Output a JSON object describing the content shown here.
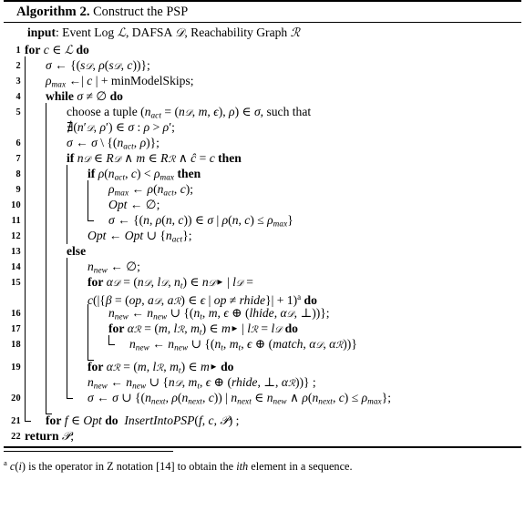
{
  "figure": {
    "caption_label": "Algorithm 2.",
    "caption_title": "Construct the PSP",
    "input_label": "input",
    "input_text": ": Event Log ℒ, DAFSA 𝒟, Reachability Graph ℛ"
  },
  "lines": [
    {
      "no": "1",
      "text": "for c ∈ ℒ do"
    },
    {
      "no": "2",
      "text": "σ ← {(s𝒟, ρ(s𝒟, c))};"
    },
    {
      "no": "3",
      "text": "ρmax ← | c | + minModelSkips;"
    },
    {
      "no": "4",
      "text": "while σ ≠ ∅ do"
    },
    {
      "no": "5",
      "text": "choose a tuple (nact = (n𝒟, m, ϵ), ρ) ∈ σ, such that ∄(n′𝒟, ρ′) ∈ σ : ρ > ρ′;"
    },
    {
      "no": "6",
      "text": "σ ← σ \\ {(nact, ρ)};"
    },
    {
      "no": "7",
      "text": "if n𝒟 ∈ R𝒟 ∧ m ∈ Rℛ ∧ ĉ = c then"
    },
    {
      "no": "8",
      "text": "if ρ(nact, c) < ρmax then"
    },
    {
      "no": "9",
      "text": "ρmax ← ρ(nact, c);"
    },
    {
      "no": "10",
      "text": "Opt ← ∅;"
    },
    {
      "no": "11",
      "text": "σ ← {(n, ρ(n, c)) ∈ σ | ρ(n, c) ≤ ρmax}"
    },
    {
      "no": "12",
      "text": "Opt ← Opt ∪ {nact};"
    },
    {
      "no": "13",
      "text": "else"
    },
    {
      "no": "14",
      "text": "nnew ← ∅;"
    },
    {
      "no": "15",
      "text": "for α𝒟 = (n𝒟, l𝒟, nt) ∈ n𝒟▶ | l𝒟 = c(|{β = (op, a𝒟, aℛ) ∈ ϵ | op ≠ rhide}| + 1)a do"
    },
    {
      "no": "16",
      "text": "nnew ← nnew ∪ {(nt, m, ϵ ⊕ (lhide, α𝒟, ⊥))};"
    },
    {
      "no": "17",
      "text": "for αℛ = (m, lℛ, mt) ∈ m▶ | lℛ = l𝒟 do"
    },
    {
      "no": "18",
      "text": "nnew ← nnew ∪ {(nt, mt, ϵ ⊕ (match, α𝒟, αℛ))}"
    },
    {
      "no": "19",
      "text": "for αℛ = (m, lℛ, mt) ∈ m▶ do nnew ← nnew ∪ {n𝒟, mt, ϵ ⊕ (rhide, ⊥, αℛ))} ;"
    },
    {
      "no": "20",
      "text": "σ ← σ ∪ {(nnext, ρ(nnext, c)) | nnext ∈ nnew ∧ ρ(nnext, c) ≤ ρmax};"
    },
    {
      "no": "21",
      "text": "for f ∈ Opt do InsertIntoPSP(f, c, 𝒫) ;"
    },
    {
      "no": "22",
      "text": "return 𝒫;"
    }
  ],
  "footnote": {
    "marker": "a",
    "text": "c(i) is the operator in Z notation [14] to obtain the ith element in a sequence."
  }
}
